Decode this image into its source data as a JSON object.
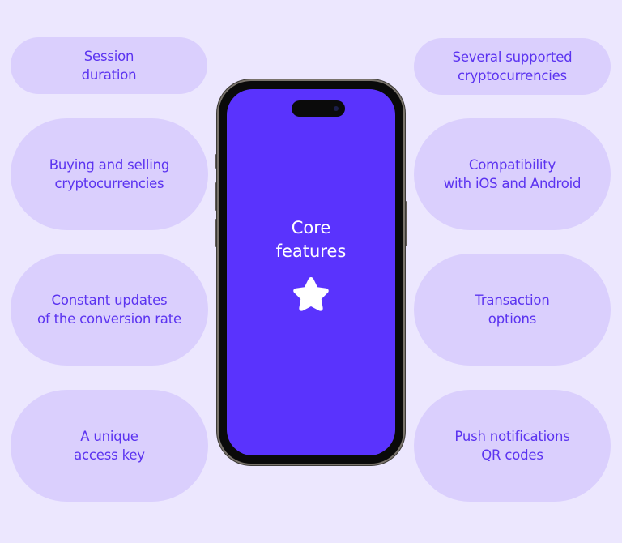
{
  "center": {
    "title": "Core\nfeatures",
    "icon": "star-icon"
  },
  "left_features": [
    {
      "label": "Session\nduration"
    },
    {
      "label": "Buying and selling\ncryptocurrencies"
    },
    {
      "label": "Constant updates\nof the conversion rate"
    },
    {
      "label": "A unique\naccess key"
    }
  ],
  "right_features": [
    {
      "label": "Several supported\ncryptocurrencies"
    },
    {
      "label": "Compatibility\nwith iOS and Android"
    },
    {
      "label": "Transaction\noptions"
    },
    {
      "label": "Push notifications\nQR codes"
    }
  ],
  "colors": {
    "background": "#ece7fe",
    "pill": "#dacffd",
    "accent_text": "#5b33f0",
    "screen": "#5a33fd"
  }
}
